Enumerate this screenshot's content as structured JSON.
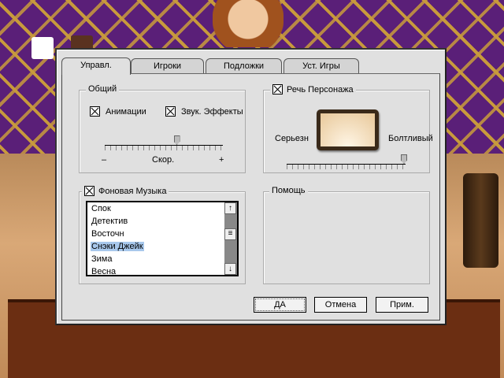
{
  "tabs": [
    {
      "label": "Управл.",
      "active": true
    },
    {
      "label": "Игроки"
    },
    {
      "label": "Подложки"
    },
    {
      "label": "Уст. Игры"
    }
  ],
  "general": {
    "title": "Общий",
    "animations": {
      "label": "Анимации",
      "checked": true
    },
    "sound_effects": {
      "label": "Звук. Эффекты",
      "checked": true
    },
    "speed": {
      "label": "Скор.",
      "min_label": "–",
      "max_label": "+",
      "value": 0.61
    }
  },
  "speech": {
    "label": "Речь Персонажа",
    "checked": true,
    "left_label": "Серьезн",
    "right_label": "Болтливый",
    "value": 1.0
  },
  "music": {
    "label": "Фоновая Музыка",
    "checked": true,
    "items": [
      "Спок",
      "Детектив",
      "Восточн",
      "Снэки Джейк",
      "Зима",
      "Весна"
    ],
    "selected": 3,
    "scroll_up": "↑",
    "scroll_down": "↓"
  },
  "help": {
    "title": "Помощь"
  },
  "buttons": {
    "ok": "ДА",
    "cancel": "Отмена",
    "apply": "Прим."
  },
  "colors": {
    "selection": "#a8c8ec",
    "background_purple": "#5a1f78"
  }
}
